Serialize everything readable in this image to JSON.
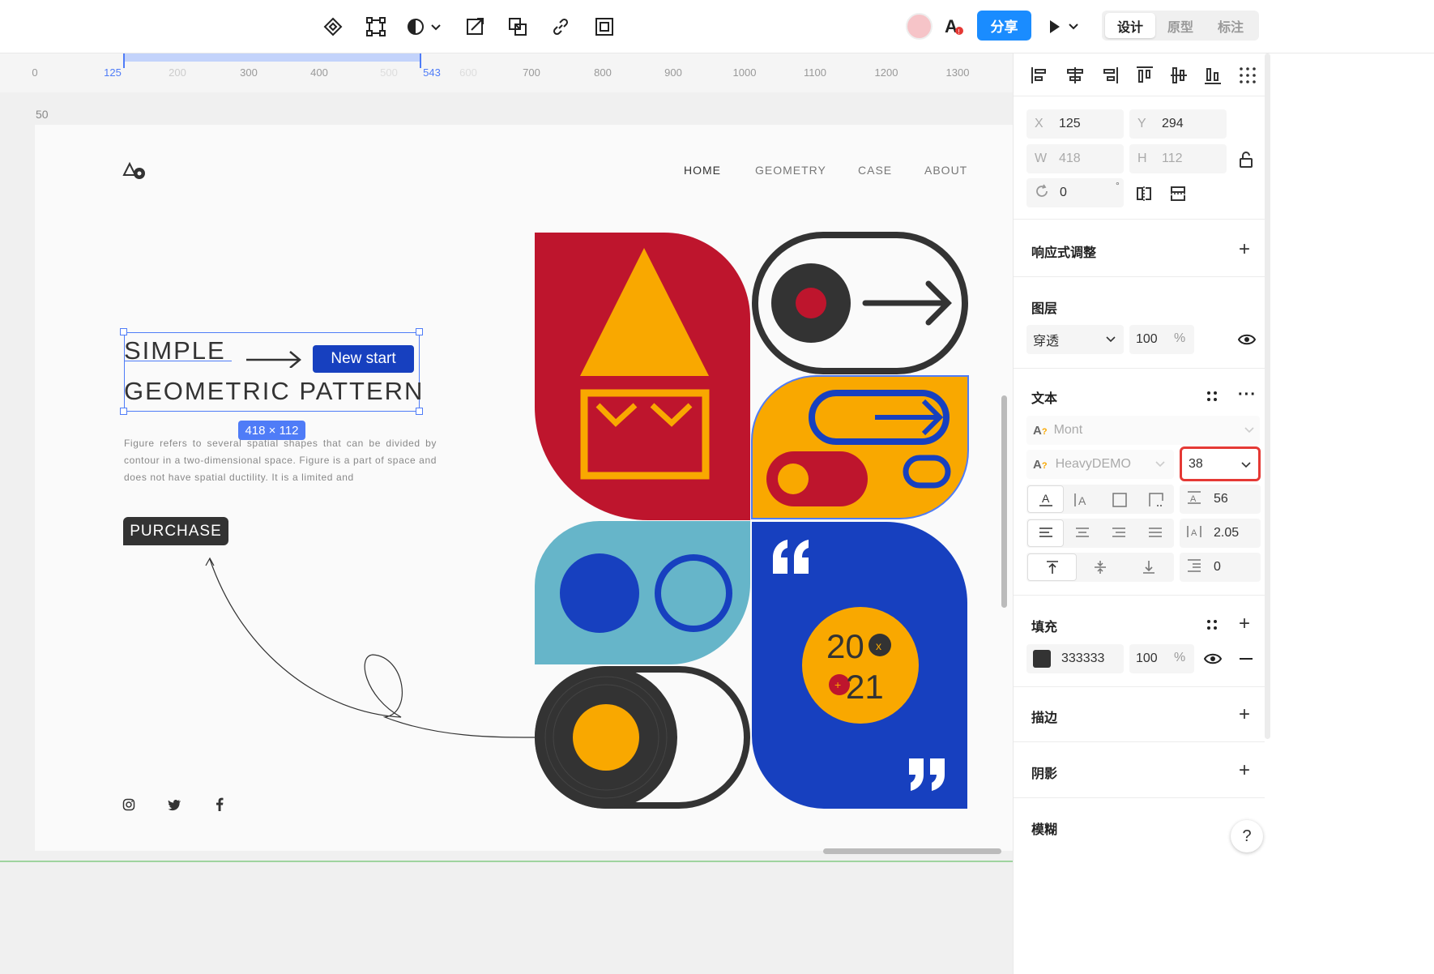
{
  "toolbar": {
    "share_label": "分享",
    "modes": [
      "设计",
      "原型",
      "标注"
    ],
    "active_mode": "设计"
  },
  "ruler": {
    "ticks": [
      "0",
      "125",
      "200",
      "300",
      "400",
      "500",
      "543",
      "600",
      "700",
      "800",
      "900",
      "1000",
      "1100",
      "1200",
      "1300"
    ],
    "selection_start": "125",
    "selection_end": "543",
    "vertical_marker": "50"
  },
  "artboard": {
    "nav": [
      "HOME",
      "GEOMETRY",
      "CASE",
      "ABOUT"
    ],
    "title_line1": "SIMPLE",
    "title_line2": "GEOMETRIC PATTERN",
    "badge": "New start",
    "size_label": "418 × 112",
    "body_text": "Figure refers to several spatial shapes that can be divided by contour in a two-dimensional space. Figure is a part of space and does not have spatial ductility. It is a limited and",
    "purchase_label": "PURCHASE",
    "year_top": "20",
    "year_bottom": "21",
    "x_mark": "x",
    "plus_mark": "+"
  },
  "panel": {
    "x_label": "X",
    "x_value": "125",
    "y_label": "Y",
    "y_value": "294",
    "w_label": "W",
    "w_value": "418",
    "h_label": "H",
    "h_value": "112",
    "rotation_value": "0",
    "degree": "°",
    "responsive_title": "响应式调整",
    "layer_title": "图层",
    "blend_mode": "穿透",
    "layer_opacity": "100",
    "percent": "%",
    "text_title": "文本",
    "font_family": "Mont",
    "font_weight": "HeavyDEMO",
    "font_size": "38",
    "line_height": "56",
    "letter_spacing": "2.05",
    "paragraph_spacing": "0",
    "fill_title": "填充",
    "fill_color": "333333",
    "fill_opacity": "100",
    "stroke_title": "描边",
    "shadow_title": "阴影",
    "blur_title": "模糊",
    "help": "?"
  },
  "colors": {
    "accent": "#1a8cff",
    "red": "#be152d",
    "yellow": "#f9a800",
    "blue": "#1740bf",
    "teal": "#66b5c9",
    "dark": "#333333",
    "highlight": "#e53935"
  }
}
